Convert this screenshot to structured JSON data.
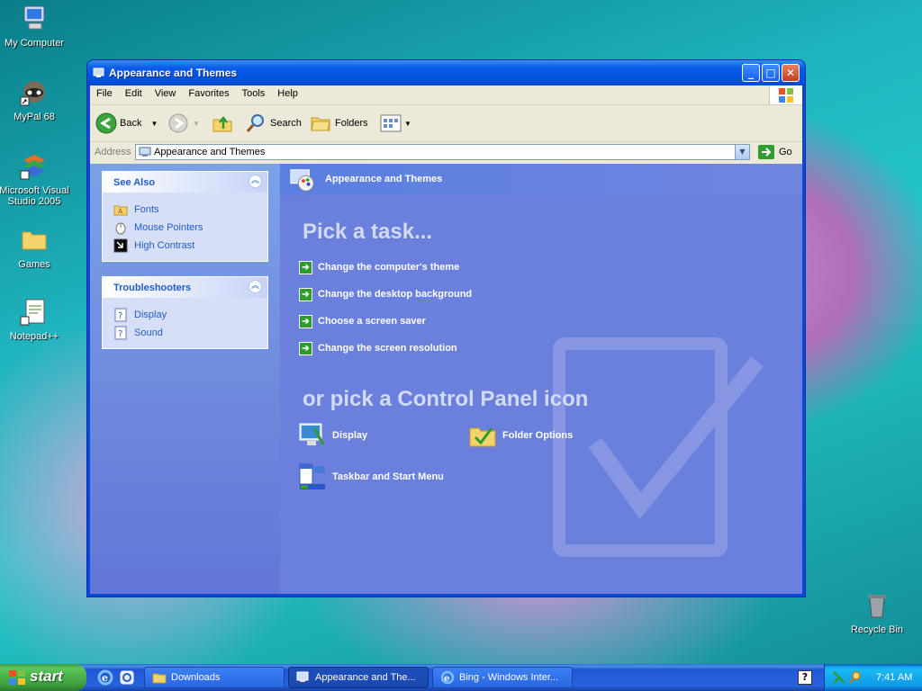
{
  "desktop": {
    "icons": [
      {
        "label": "My Computer"
      },
      {
        "label": "MyPal 68"
      },
      {
        "label": "Microsoft Visual Studio 2005"
      },
      {
        "label": "Games"
      },
      {
        "label": "Notepad++"
      },
      {
        "label": "Recycle Bin"
      }
    ]
  },
  "window": {
    "title": "Appearance and Themes",
    "menu": [
      "File",
      "Edit",
      "View",
      "Favorites",
      "Tools",
      "Help"
    ],
    "toolbar": {
      "back": "Back",
      "search": "Search",
      "folders": "Folders"
    },
    "address": {
      "label": "Address",
      "value": "Appearance and Themes",
      "go": "Go"
    },
    "see_also": {
      "title": "See Also",
      "links": [
        "Fonts",
        "Mouse Pointers",
        "High Contrast"
      ]
    },
    "troubleshooters": {
      "title": "Troubleshooters",
      "links": [
        "Display",
        "Sound"
      ]
    },
    "main": {
      "header": "Appearance and Themes",
      "pick_task": "Pick a task...",
      "tasks": [
        "Change the computer's theme",
        "Change the desktop background",
        "Choose a screen saver",
        "Change the screen resolution"
      ],
      "pick_icon": "or pick a Control Panel icon",
      "icons": [
        "Display",
        "Folder Options",
        "Taskbar and Start Menu"
      ]
    }
  },
  "taskbar": {
    "start": "start",
    "buttons": [
      "Downloads",
      "Appearance and The...",
      "Bing - Windows Inter..."
    ],
    "clock": "7:41 AM"
  },
  "colors": {
    "accent": "#215dc6",
    "task_arrow": "#2e9c2e",
    "taskbar": "#2663da"
  }
}
